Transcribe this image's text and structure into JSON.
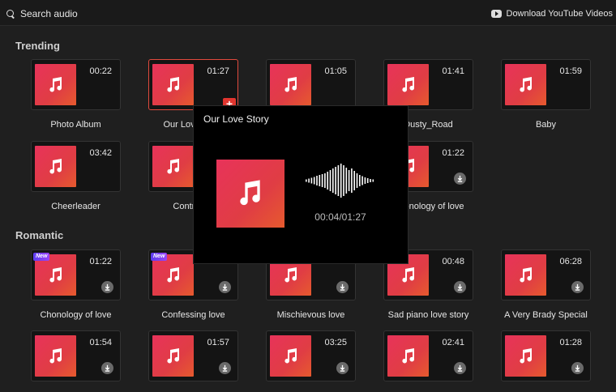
{
  "topbar": {
    "search_label": "Search audio",
    "download_label": "Download YouTube Videos"
  },
  "sections": {
    "trending": "Trending",
    "romantic": "Romantic"
  },
  "cards": [
    {
      "duration": "00:22",
      "label": "Photo Album"
    },
    {
      "duration": "01:27",
      "label": "Our Love Story"
    },
    {
      "duration": "01:05",
      "label": ""
    },
    {
      "duration": "01:41",
      "label": "Dusty_Road"
    },
    {
      "duration": "01:59",
      "label": "Baby"
    },
    {
      "duration": "03:42",
      "label": "Cheerleader"
    },
    {
      "duration": "",
      "label": "Controlled"
    },
    {
      "duration": "01:22",
      "label": "Chonology of love"
    },
    {
      "duration": "01:22",
      "label": "Chonology of love",
      "badge": "New"
    },
    {
      "duration": "01:22",
      "label": "Confessing love",
      "badge": "New"
    },
    {
      "duration": "",
      "label": "Mischievous love"
    },
    {
      "duration": "00:48",
      "label": "Sad piano love story"
    },
    {
      "duration": "06:28",
      "label": "A Very Brady Special"
    },
    {
      "duration": "01:54",
      "label": ""
    },
    {
      "duration": "01:57",
      "label": ""
    },
    {
      "duration": "03:25",
      "label": ""
    },
    {
      "duration": "02:41",
      "label": ""
    },
    {
      "duration": "01:28",
      "label": ""
    }
  ],
  "add_symbol": "+",
  "preview": {
    "title": "Our Love Story",
    "time": "00:04/01:27"
  },
  "colors": {
    "accent": "#e2352f",
    "cover_start": "#e8335a",
    "cover_end": "#e65a2e",
    "badge": "#7a40f2"
  }
}
